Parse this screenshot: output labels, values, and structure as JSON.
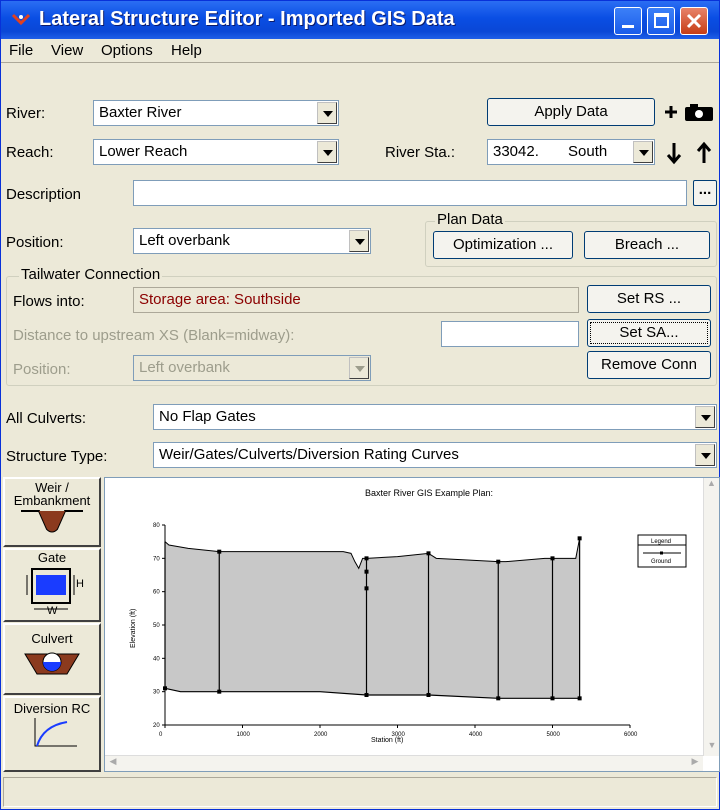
{
  "window": {
    "title": "Lateral Structure Editor - Imported GIS Data"
  },
  "menu": {
    "file": "File",
    "view": "View",
    "options": "Options",
    "help": "Help"
  },
  "river": {
    "label": "River:",
    "value": "Baxter River"
  },
  "reach": {
    "label": "Reach:",
    "value": "Lower Reach"
  },
  "apply_label": "Apply Data",
  "river_sta": {
    "label": "River Sta.:",
    "value": "33042.",
    "side": "South"
  },
  "description": {
    "label": "Description",
    "value": "",
    "more": "..."
  },
  "position": {
    "label": "Position:",
    "value": "Left overbank"
  },
  "plan_data": {
    "title": "Plan Data",
    "optimization": "Optimization ...",
    "breach": "Breach ..."
  },
  "tailwater": {
    "title": "Tailwater Connection",
    "flows_label": "Flows into:",
    "flows_value": "Storage area: Southside",
    "set_rs": "Set RS ...",
    "distance_label": "Distance to upstream XS (Blank=midway):",
    "distance_value": "",
    "set_sa": "Set SA...",
    "position_label": "Position:",
    "position_value": "Left overbank",
    "remove": "Remove Conn"
  },
  "culverts": {
    "label": "All Culverts:",
    "value": "No Flap Gates"
  },
  "structure": {
    "label": "Structure Type:",
    "value": "Weir/Gates/Culverts/Diversion Rating Curves"
  },
  "side_buttons": {
    "weir": "Weir / Embankment",
    "gate": "Gate",
    "gate_h": "H",
    "gate_w": "W",
    "culvert": "Culvert",
    "diversion": "Diversion RC"
  },
  "chart_data": {
    "type": "area",
    "title": "Baxter River GIS Example      Plan:",
    "xlabel": "Station (ft)",
    "ylabel": "Elevation (ft)",
    "xlim": [
      0,
      6000
    ],
    "ylim": [
      20,
      80
    ],
    "xticks": [
      "0",
      "1000",
      "2000",
      "3000",
      "4000",
      "5000",
      "6000"
    ],
    "yticks": [
      "20",
      "30",
      "40",
      "50",
      "60",
      "70",
      "80"
    ],
    "legend": {
      "title": "Legend",
      "series": "Ground"
    },
    "top": [
      [
        0,
        75
      ],
      [
        50,
        74
      ],
      [
        300,
        73
      ],
      [
        700,
        72
      ],
      [
        1200,
        72
      ],
      [
        2000,
        72
      ],
      [
        2300,
        72
      ],
      [
        2400,
        71.5
      ],
      [
        2450,
        69
      ],
      [
        2500,
        67
      ],
      [
        2550,
        70
      ],
      [
        2600,
        70
      ],
      [
        3000,
        70.5
      ],
      [
        3400,
        71.5
      ],
      [
        3500,
        70
      ],
      [
        4300,
        69
      ],
      [
        4400,
        69
      ],
      [
        4900,
        70
      ],
      [
        5000,
        70
      ],
      [
        5300,
        70
      ],
      [
        5350,
        76
      ]
    ],
    "bottom": [
      [
        0,
        31
      ],
      [
        200,
        30
      ],
      [
        700,
        30
      ],
      [
        1500,
        30
      ],
      [
        2000,
        30
      ],
      [
        2600,
        29
      ],
      [
        3400,
        29
      ],
      [
        4300,
        28
      ],
      [
        5000,
        28
      ],
      [
        5350,
        28
      ]
    ],
    "verticals": [
      [
        0,
        31,
        75
      ],
      [
        700,
        30,
        72
      ],
      [
        2600,
        29,
        70
      ],
      [
        3400,
        29,
        71.5
      ],
      [
        4300,
        28,
        69
      ],
      [
        5000,
        28,
        70
      ],
      [
        5350,
        28,
        76
      ]
    ],
    "points": [
      [
        2600,
        66
      ],
      [
        2600,
        61
      ],
      [
        2600,
        70
      ],
      [
        3400,
        71.5
      ],
      [
        4300,
        69
      ],
      [
        5000,
        70
      ],
      [
        5350,
        76
      ],
      [
        700,
        72
      ],
      [
        0,
        31
      ],
      [
        700,
        30
      ],
      [
        2600,
        29
      ],
      [
        3400,
        29
      ],
      [
        4300,
        28
      ],
      [
        5000,
        28
      ],
      [
        5350,
        28
      ]
    ]
  }
}
